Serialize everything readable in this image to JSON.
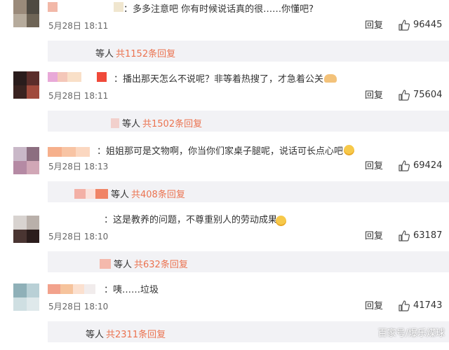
{
  "comments": [
    {
      "text": "：多多注意吧 你有时候说话真的很……你懂吧?",
      "time": "5月28日 18:11",
      "reply_label": "回复",
      "likes": "96445",
      "sub_prefix": "等人",
      "sub_count": "共1152条回复"
    },
    {
      "text": "：播出那天怎么不说呢？非等着热搜了，才急着公关",
      "time": "5月28日 18:11",
      "reply_label": "回复",
      "likes": "75604",
      "sub_prefix": "等人",
      "sub_count": "共1502条回复"
    },
    {
      "text": "：姐姐那可是文物啊，你当你们家桌子腿呢，说话可长点心吧",
      "time": "5月28日 18:13",
      "reply_label": "回复",
      "likes": "69424",
      "sub_prefix": "等人",
      "sub_count": "共408条回复"
    },
    {
      "text": "：这是教养的问题，不尊重别人的劳动成果",
      "time": "5月28日 18:10",
      "reply_label": "回复",
      "likes": "63187",
      "sub_prefix": "等人",
      "sub_count": "共632条回复"
    },
    {
      "text": "：咦……垃圾",
      "time": "5月28日 18:10",
      "reply_label": "回复",
      "likes": "41743",
      "sub_prefix": "等人",
      "sub_count": "共2311条回复"
    }
  ],
  "watermark": "百家号/爆乐煤球",
  "colors": {
    "link_orange": "#eb7350",
    "sub_bg": "#f2f2f5",
    "meta_gray": "#666666"
  },
  "icons": {
    "like": "thumbs-up-icon",
    "emoji": "smiley-emoji-icon"
  }
}
